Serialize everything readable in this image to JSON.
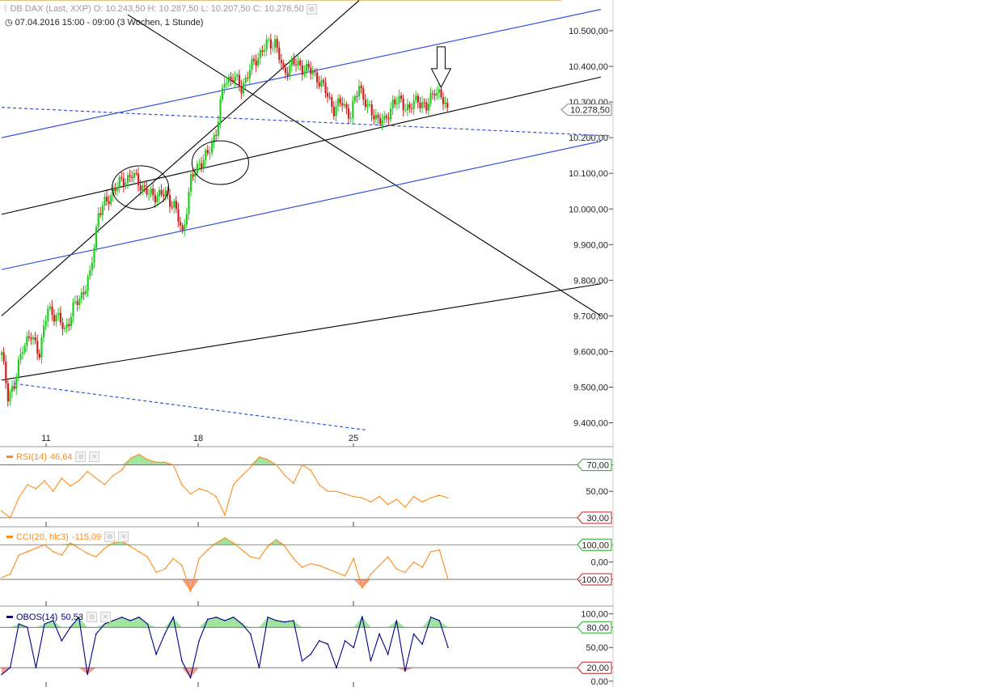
{
  "header": {
    "symbol": "DB DAX",
    "qualifier": "(Last, XXP)",
    "ohlc": "O: 10.243,50   H: 10.287,50   L: 10.207,50   C: 10.278,50",
    "range": "07.04.2016 15:00 - 09:00 (3 Wochen, 1 Stunde)"
  },
  "icons": [
    "settings-icon",
    "clock-icon",
    "close-icon",
    "down-arrow-annotation-icon"
  ],
  "colors": {
    "up_candle": "#22cc22",
    "down_candle": "#cc2222",
    "trend_black": "#000000",
    "trend_blue": "#2244dd",
    "rsi_line": "#ff8c1a",
    "cci_line": "#ff8c1a",
    "obos_line": "#000088",
    "fill_positive": "#88dd88",
    "fill_negative": "#ee8877",
    "last_price_tag": "#888888"
  },
  "chart_data": [
    {
      "type": "candlestick",
      "title": "DB DAX",
      "interval": "1 Stunde",
      "x_tick_labels": [
        "11",
        "18",
        "25"
      ],
      "y_tick_labels": [
        "10.500,00",
        "10.400,00",
        "10.300,00",
        "10.200,00",
        "10.100,00",
        "10.000,00",
        "9.900,00",
        "9.800,00",
        "9.700,00",
        "9.600,00",
        "9.500,00",
        "9.400,00"
      ],
      "ylim": [
        9370,
        10570
      ],
      "last_value_label": "10.278,50",
      "last_value": 10278.5,
      "price_path": [
        {
          "i": 0,
          "v": 9590
        },
        {
          "i": 3,
          "v": 9480
        },
        {
          "i": 6,
          "v": 9500
        },
        {
          "i": 10,
          "v": 9620
        },
        {
          "i": 14,
          "v": 9640
        },
        {
          "i": 18,
          "v": 9600
        },
        {
          "i": 22,
          "v": 9720
        },
        {
          "i": 26,
          "v": 9700
        },
        {
          "i": 30,
          "v": 9660
        },
        {
          "i": 34,
          "v": 9720
        },
        {
          "i": 38,
          "v": 9760
        },
        {
          "i": 42,
          "v": 9810
        },
        {
          "i": 46,
          "v": 9990
        },
        {
          "i": 50,
          "v": 10020
        },
        {
          "i": 54,
          "v": 10060
        },
        {
          "i": 58,
          "v": 10080
        },
        {
          "i": 62,
          "v": 10095
        },
        {
          "i": 66,
          "v": 10070
        },
        {
          "i": 70,
          "v": 10040
        },
        {
          "i": 74,
          "v": 10040
        },
        {
          "i": 78,
          "v": 10040
        },
        {
          "i": 82,
          "v": 10010
        },
        {
          "i": 86,
          "v": 9930
        },
        {
          "i": 90,
          "v": 10080
        },
        {
          "i": 94,
          "v": 10130
        },
        {
          "i": 98,
          "v": 10150
        },
        {
          "i": 102,
          "v": 10220
        },
        {
          "i": 106,
          "v": 10360
        },
        {
          "i": 110,
          "v": 10370
        },
        {
          "i": 114,
          "v": 10340
        },
        {
          "i": 118,
          "v": 10390
        },
        {
          "i": 122,
          "v": 10430
        },
        {
          "i": 126,
          "v": 10460
        },
        {
          "i": 130,
          "v": 10470
        },
        {
          "i": 134,
          "v": 10380
        },
        {
          "i": 138,
          "v": 10410
        },
        {
          "i": 142,
          "v": 10400
        },
        {
          "i": 146,
          "v": 10390
        },
        {
          "i": 150,
          "v": 10370
        },
        {
          "i": 154,
          "v": 10330
        },
        {
          "i": 158,
          "v": 10280
        },
        {
          "i": 162,
          "v": 10300
        },
        {
          "i": 166,
          "v": 10260
        },
        {
          "i": 170,
          "v": 10350
        },
        {
          "i": 174,
          "v": 10280
        },
        {
          "i": 178,
          "v": 10260
        },
        {
          "i": 182,
          "v": 10240
        },
        {
          "i": 186,
          "v": 10300
        },
        {
          "i": 190,
          "v": 10300
        },
        {
          "i": 194,
          "v": 10280
        },
        {
          "i": 198,
          "v": 10310
        },
        {
          "i": 202,
          "v": 10280
        },
        {
          "i": 206,
          "v": 10340
        },
        {
          "i": 210,
          "v": 10300
        },
        {
          "i": 212,
          "v": 10278.5
        }
      ],
      "trend_lines": [
        {
          "name": "black-rising-steep",
          "color": "black",
          "style": "solid",
          "p1": {
            "i": 0,
            "v": 9700
          },
          "p2": {
            "i": 170,
            "v": 10585
          }
        },
        {
          "name": "black-falling",
          "color": "black",
          "style": "solid",
          "p1": {
            "i": 60,
            "v": 10545
          },
          "p2": {
            "i": 285,
            "v": 9700
          }
        },
        {
          "name": "black-rising-mid",
          "color": "black",
          "style": "solid",
          "p1": {
            "i": 0,
            "v": 9985
          },
          "p2": {
            "i": 285,
            "v": 10370
          }
        },
        {
          "name": "black-rising-low",
          "color": "black",
          "style": "solid",
          "p1": {
            "i": 0,
            "v": 9520
          },
          "p2": {
            "i": 285,
            "v": 9790
          }
        },
        {
          "name": "blue-upper",
          "color": "blue",
          "style": "solid",
          "p1": {
            "i": 0,
            "v": 10200
          },
          "p2": {
            "i": 285,
            "v": 10560
          }
        },
        {
          "name": "blue-lower",
          "color": "blue",
          "style": "solid",
          "p1": {
            "i": 0,
            "v": 9830
          },
          "p2": {
            "i": 285,
            "v": 10190
          }
        },
        {
          "name": "blue-dashed-upper",
          "color": "blue",
          "style": "dashed",
          "p1": {
            "i": 0,
            "v": 10285
          },
          "p2": {
            "i": 289,
            "v": 10205
          }
        },
        {
          "name": "blue-dashed-lower",
          "color": "blue",
          "style": "dashed",
          "p1": {
            "i": 6,
            "v": 9510
          },
          "p2": {
            "i": 173,
            "v": 9380
          }
        }
      ],
      "annotations": [
        {
          "type": "ellipse",
          "center": {
            "i": 66,
            "v": 10060
          }
        },
        {
          "type": "ellipse",
          "center": {
            "i": 104,
            "v": 10130
          }
        },
        {
          "type": "down-arrow",
          "at": {
            "i": 209,
            "v": 10330
          }
        }
      ]
    },
    {
      "type": "line",
      "name": "RSI(14)",
      "value_label": "46,64",
      "levels": [
        {
          "label": "70,00",
          "v": 70
        },
        {
          "label": "30,00",
          "v": 30
        }
      ],
      "axis_labels": [
        "50,00"
      ],
      "ylim": [
        25,
        82
      ],
      "values": [
        35,
        30,
        45,
        55,
        52,
        58,
        50,
        60,
        54,
        58,
        65,
        60,
        55,
        62,
        66,
        75,
        78,
        74,
        72,
        72,
        70,
        55,
        48,
        52,
        50,
        46,
        32,
        55,
        62,
        68,
        76,
        74,
        70,
        62,
        56,
        70,
        66,
        55,
        50,
        50,
        48,
        46,
        45,
        42,
        46,
        40,
        44,
        38,
        46,
        42,
        45,
        47,
        45
      ]
    },
    {
      "type": "line",
      "name": "CCI(20, hlc3)",
      "value_label": "-115,09",
      "levels": [
        {
          "label": "100,00",
          "v": 100
        },
        {
          "label": "-100,00",
          "v": -100
        }
      ],
      "axis_labels": [
        "0,00"
      ],
      "ylim": [
        -240,
        190
      ],
      "values": [
        -90,
        -70,
        40,
        60,
        80,
        100,
        60,
        40,
        110,
        80,
        50,
        30,
        80,
        110,
        120,
        90,
        60,
        30,
        -60,
        -40,
        20,
        -20,
        -170,
        20,
        70,
        110,
        140,
        110,
        70,
        30,
        20,
        90,
        130,
        90,
        20,
        -30,
        -10,
        -20,
        -40,
        -60,
        -80,
        20,
        -150,
        -70,
        -20,
        30,
        -40,
        -60,
        0,
        -30,
        60,
        70,
        -100
      ]
    },
    {
      "type": "line",
      "name": "OBOS(14)",
      "value_label": "50,53",
      "levels": [
        {
          "label": "80,00",
          "v": 80
        },
        {
          "label": "20,00",
          "v": 20
        }
      ],
      "axis_labels": [
        "100,00",
        "50,00",
        "0,00"
      ],
      "ylim": [
        -5,
        108
      ],
      "values": [
        10,
        20,
        85,
        80,
        20,
        85,
        90,
        60,
        80,
        95,
        10,
        70,
        85,
        90,
        95,
        90,
        95,
        85,
        40,
        70,
        95,
        30,
        5,
        60,
        92,
        95,
        90,
        95,
        85,
        70,
        20,
        95,
        90,
        88,
        90,
        30,
        40,
        60,
        55,
        20,
        60,
        50,
        96,
        30,
        70,
        40,
        90,
        15,
        70,
        55,
        95,
        90,
        50
      ]
    }
  ]
}
